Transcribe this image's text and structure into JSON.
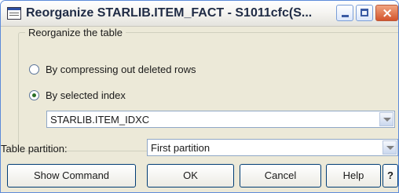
{
  "window": {
    "title": "Reorganize STARLIB.ITEM_FACT - S1011cfc(S..."
  },
  "reorganize_group": {
    "label": "Reorganize the table",
    "options": [
      {
        "label": "By compressing out deleted rows",
        "selected": false
      },
      {
        "label": "By selected index",
        "selected": true
      }
    ],
    "index_select": {
      "value": "STARLIB.ITEM_IDXC"
    }
  },
  "partition": {
    "label": "Table partition:",
    "value": "First partition"
  },
  "buttons": {
    "show_command": "Show Command",
    "ok": "OK",
    "cancel": "Cancel",
    "help": "Help",
    "whats_this": "?"
  },
  "colors": {
    "dialog_bg": "#ece9d8",
    "border_blue": "#5d8bd9",
    "close_red": "#d3542c"
  },
  "icons": {
    "app": "table-window-icon",
    "minimize": "minimize-icon",
    "maximize": "maximize-icon",
    "close": "close-icon",
    "dropdown": "chevron-down-icon"
  }
}
